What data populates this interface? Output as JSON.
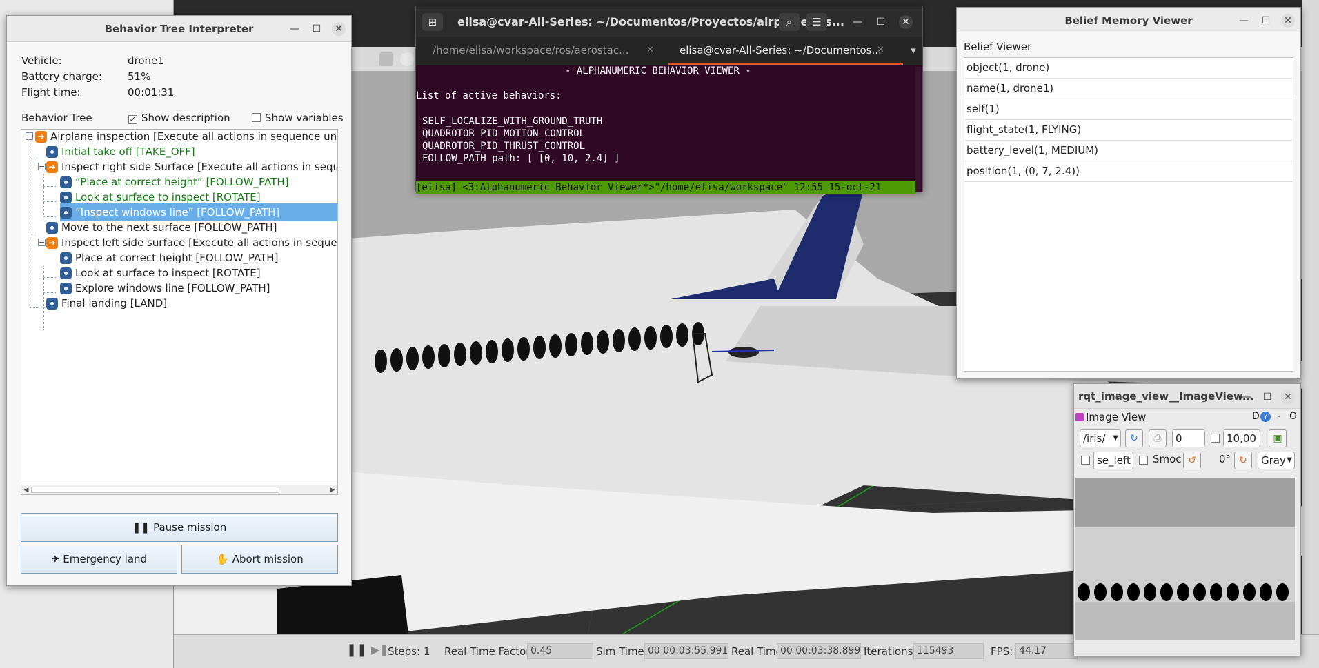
{
  "gazebo": {
    "steps_label": "Steps:",
    "steps_value": "1",
    "rtf_label": "Real Time Factor:",
    "rtf_value": "0.45",
    "sim_time_label": "Sim Time:",
    "sim_time_value": "00 00:03:55.991",
    "real_time_label": "Real Time:",
    "real_time_value": "00 00:03:38.899",
    "iterations_label": "Iterations:",
    "iterations_value": "115493",
    "fps_label": "FPS:",
    "fps_value": "44.17"
  },
  "bti": {
    "title": "Behavior Tree Interpreter",
    "vehicle_label": "Vehicle:",
    "vehicle_value": "drone1",
    "battery_label": "Battery charge:",
    "battery_value": "51%",
    "flight_label": "Flight time:",
    "flight_value": "00:01:31",
    "tree_label": "Behavior Tree",
    "show_description": "Show description",
    "show_variables": "Show variables",
    "nodes": [
      {
        "label": "Airplane inspection [Execute all actions in sequence until one"
      },
      {
        "label": "Initial take off [TAKE_OFF]"
      },
      {
        "label": "Inspect right side Surface [Execute all actions in sequence"
      },
      {
        "label": "“Place at correct height” [FOLLOW_PATH]"
      },
      {
        "label": "Look at surface to inspect [ROTATE]"
      },
      {
        "label": "“Inspect windows line” [FOLLOW_PATH]"
      },
      {
        "label": "Move to the next surface [FOLLOW_PATH]"
      },
      {
        "label": "Inspect left side surface [Execute all actions in sequence u"
      },
      {
        "label": "Place at correct height [FOLLOW_PATH]"
      },
      {
        "label": "Look at surface to inspect [ROTATE]"
      },
      {
        "label": "Explore windows line [FOLLOW_PATH]"
      },
      {
        "label": "Final landing [LAND]"
      }
    ],
    "pause_label": "Pause mission",
    "emergency_label": "Emergency land",
    "abort_label": "Abort mission"
  },
  "terminal": {
    "title": "elisa@cvar-All-Series: ~/Documentos/Proyectos/airplane_ins...",
    "tab1": "/home/elisa/workspace/ros/aerostac...",
    "tab2": "elisa@cvar-All-Series: ~/Documentos...",
    "header": "- ALPHANUMERIC BEHAVIOR VIEWER -",
    "subheader": "List of active behaviors:",
    "lines": [
      "SELF_LOCALIZE_WITH_GROUND_TRUTH",
      "QUADROTOR_PID_MOTION_CONTROL",
      "QUADROTOR_PID_THRUST_CONTROL",
      "FOLLOW_PATH path: [ [0, 10, 2.4] ]"
    ],
    "status": "[elisa] <3:Alphanumeric Behavior Viewer*>\"/home/elisa/workspace\" 12:55 15-oct-21"
  },
  "belief": {
    "title": "Belief Memory Viewer",
    "section": "Belief Viewer",
    "rows": [
      "object(1, drone)",
      "name(1, drone1)",
      "self(1)",
      "flight_state(1, FLYING)",
      "battery_level(1, MEDIUM)",
      "position(1, (0, 7, 2.4))"
    ]
  },
  "rqt": {
    "title": "rqt_image_view__ImageView...",
    "plugin_label": "Image View",
    "d_label": "D",
    "dash_label": "-",
    "o_label": "O",
    "topic": "/iris/",
    "spin_value": "0",
    "max_value": "10,00",
    "suffix_field": "se_left",
    "smooth_label": "Smoc",
    "rotation": "0°",
    "color_scheme": "Gray"
  },
  "colors": {
    "accent_select": "#6aaee8",
    "sequence_icon": "#ef7d10",
    "action_icon": "#2f5f96",
    "terminal_bg": "#300a24",
    "terminal_status": "#4e9a06",
    "active_node_text": "#1a7a1a"
  }
}
